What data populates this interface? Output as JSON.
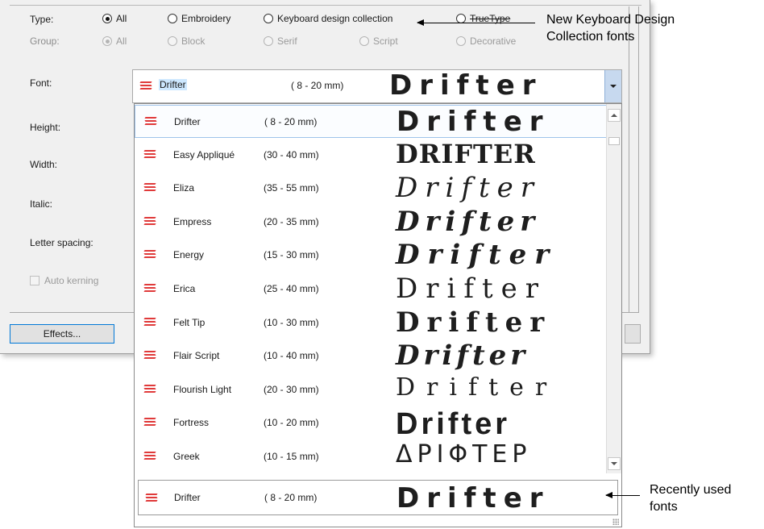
{
  "filter": {
    "type_label": "Type:",
    "group_label": "Group:",
    "type_options": [
      {
        "label": "All",
        "selected": true
      },
      {
        "label": "Embroidery",
        "selected": false
      },
      {
        "label": "Keyboard design collection",
        "selected": false
      },
      {
        "label": "TrueType",
        "selected": false
      }
    ],
    "group_options": [
      {
        "label": "All",
        "selected": true
      },
      {
        "label": "Block",
        "selected": false
      },
      {
        "label": "Serif",
        "selected": false
      },
      {
        "label": "Script",
        "selected": false
      },
      {
        "label": "Decorative",
        "selected": false
      }
    ]
  },
  "font_select": {
    "label": "Font:",
    "value": "Drifter",
    "size": "( 8 - 20 mm)",
    "preview": "Drifter"
  },
  "side_labels": {
    "height": "Height:",
    "width": "Width:",
    "italic": "Italic:",
    "letter_spacing": "Letter spacing:",
    "auto_kerning": "Auto kerning"
  },
  "effects_button": "Effects...",
  "font_list": [
    {
      "name": "Drifter",
      "size": "( 8 - 20 mm)",
      "preview": "Drifter"
    },
    {
      "name": "Easy Appliqué",
      "size": "(30 - 40 mm)",
      "preview": "DRIFTER"
    },
    {
      "name": "Eliza",
      "size": "(35 - 55 mm)",
      "preview": "Drifter"
    },
    {
      "name": "Empress",
      "size": "(20 - 35 mm)",
      "preview": "Drifter"
    },
    {
      "name": "Energy",
      "size": "(15 - 30 mm)",
      "preview": "Drifter"
    },
    {
      "name": "Erica",
      "size": "(25 - 40 mm)",
      "preview": "Drifter"
    },
    {
      "name": "Felt Tip",
      "size": "(10 - 30 mm)",
      "preview": "Drifter"
    },
    {
      "name": "Flair Script",
      "size": "(10 - 40 mm)",
      "preview": "Drifter"
    },
    {
      "name": "Flourish Light",
      "size": "(20 - 30 mm)",
      "preview": "Drifter"
    },
    {
      "name": "Fortress",
      "size": "(10 - 20 mm)",
      "preview": "Drifter"
    },
    {
      "name": "Greek",
      "size": "(10 - 15 mm)",
      "preview": "ΔΡΙΦΤΕΡ"
    }
  ],
  "recent": {
    "name": "Drifter",
    "size": "( 8 - 20 mm)",
    "preview": "Drifter"
  },
  "annotations": {
    "keyboard_line1": "New Keyboard Design",
    "keyboard_line2": "Collection fonts",
    "recent_line1": "Recently used",
    "recent_line2": "fonts"
  },
  "colors": {
    "font_icon": "#e03a3a",
    "selection": "#cde8ff",
    "focus_border": "#0078d7"
  }
}
